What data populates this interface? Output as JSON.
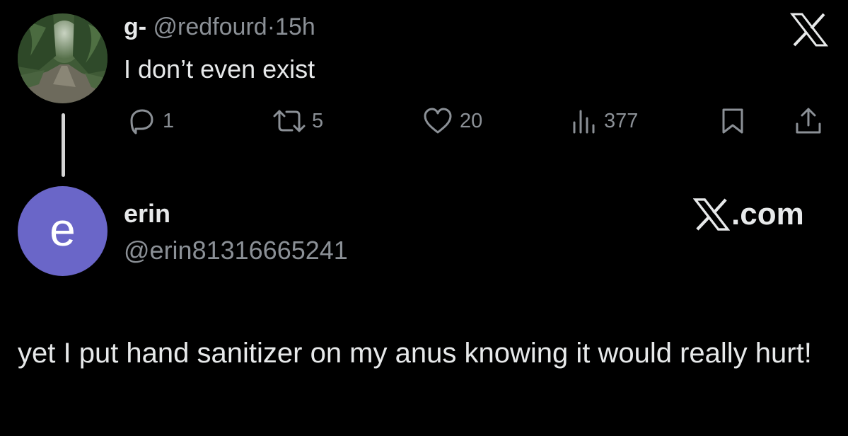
{
  "original_tweet": {
    "display_name": "g-",
    "handle": "@redfourd",
    "separator": "·",
    "time_ago": "15h",
    "text": "I don’t even exist",
    "avatar_icon": "forest-path-photo",
    "actions": {
      "replies": "1",
      "retweets": "5",
      "likes": "20",
      "views": "377"
    },
    "platform_icon": "x-logo-icon"
  },
  "reply": {
    "avatar_letter": "e",
    "display_name": "erin",
    "handle": "@erin81316665241",
    "brand": ".com",
    "text": "yet I put hand sanitizer on my anus knowing it would really hurt!"
  },
  "colors": {
    "background": "#000000",
    "primary_text": "#e7e9ea",
    "secondary_text": "#8b9096",
    "avatar_purple": "#6a66c8",
    "thread_line": "#d5d5d5"
  }
}
